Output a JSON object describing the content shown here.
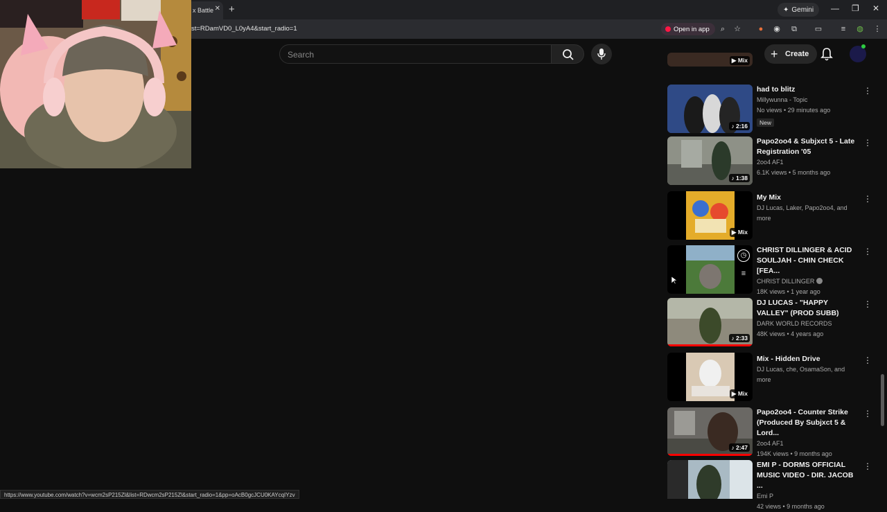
{
  "browser": {
    "tab_title": "x Battle",
    "url": "st=RDamVD0_L0yA4&start_radio=1",
    "gemini_label": "Gemini",
    "open_in_app_label": "Open in app",
    "status_url": "https://www.youtube.com/watch?v=wcm2sP215Zl&list=RDwcm2sP215Zl&start_radio=1&pp=oAcB0gcJCU0KAYcqIYzv"
  },
  "youtube": {
    "search_placeholder": "Search",
    "create_label": "Create"
  },
  "recommendations": [
    {
      "title": "had to blitz",
      "channel": "Millywunna - Topic",
      "stats": "No views • 29 minutes ago",
      "badge": "New",
      "duration": "2:16",
      "thumb_color": "#2f3f6a"
    },
    {
      "title": "Papo2oo4 & Subjxct 5 - Late Registration '05",
      "channel": "2oo4 AF1",
      "stats": "6.1K views • 5 months ago",
      "duration": "1:38",
      "thumb_color": "#6c7060"
    },
    {
      "title": "My Mix",
      "channel": "DJ Lucas, Laker, Papo2oo4, and more",
      "stats": "",
      "duration": "Mix",
      "thumb_color": "#d9a52a"
    },
    {
      "title": "CHRIST DILLINGER & ACID SOULJAH - CHIN CHECK [FEA...",
      "channel": "CHRIST DILLINGER",
      "stats": "18K views • 1 year ago",
      "duration": "",
      "thumb_color": "#4f6a3a"
    },
    {
      "title": "DJ LUCAS - \"HAPPY VALLEY\" (PROD SUBB)",
      "channel": "DARK WORLD RECORDS",
      "stats": "48K views • 4 years ago",
      "duration": "2:33",
      "thumb_color": "#7a6f5e",
      "progress": 1.0
    },
    {
      "title": "Mix - Hidden Drive",
      "channel": "DJ Lucas, che, OsamaSon, and more",
      "stats": "",
      "duration": "Mix",
      "thumb_color": "#c9b9a4"
    },
    {
      "title": "Papo2oo4 - Counter Strike (Produced By Subjxct 5 & Lord...",
      "channel": "2oo4 AF1",
      "stats": "194K views • 9 months ago",
      "duration": "2:47",
      "thumb_color": "#595651",
      "progress": 1.0
    },
    {
      "title": "EMI P - DORMS OFFICIAL MUSIC VIDEO - DIR. JACOB ...",
      "channel": "Emi P",
      "stats": "42 views • 9 months ago",
      "duration": "",
      "thumb_color": "#8fa4b0"
    }
  ],
  "top_partial": {
    "duration": "Mix"
  }
}
